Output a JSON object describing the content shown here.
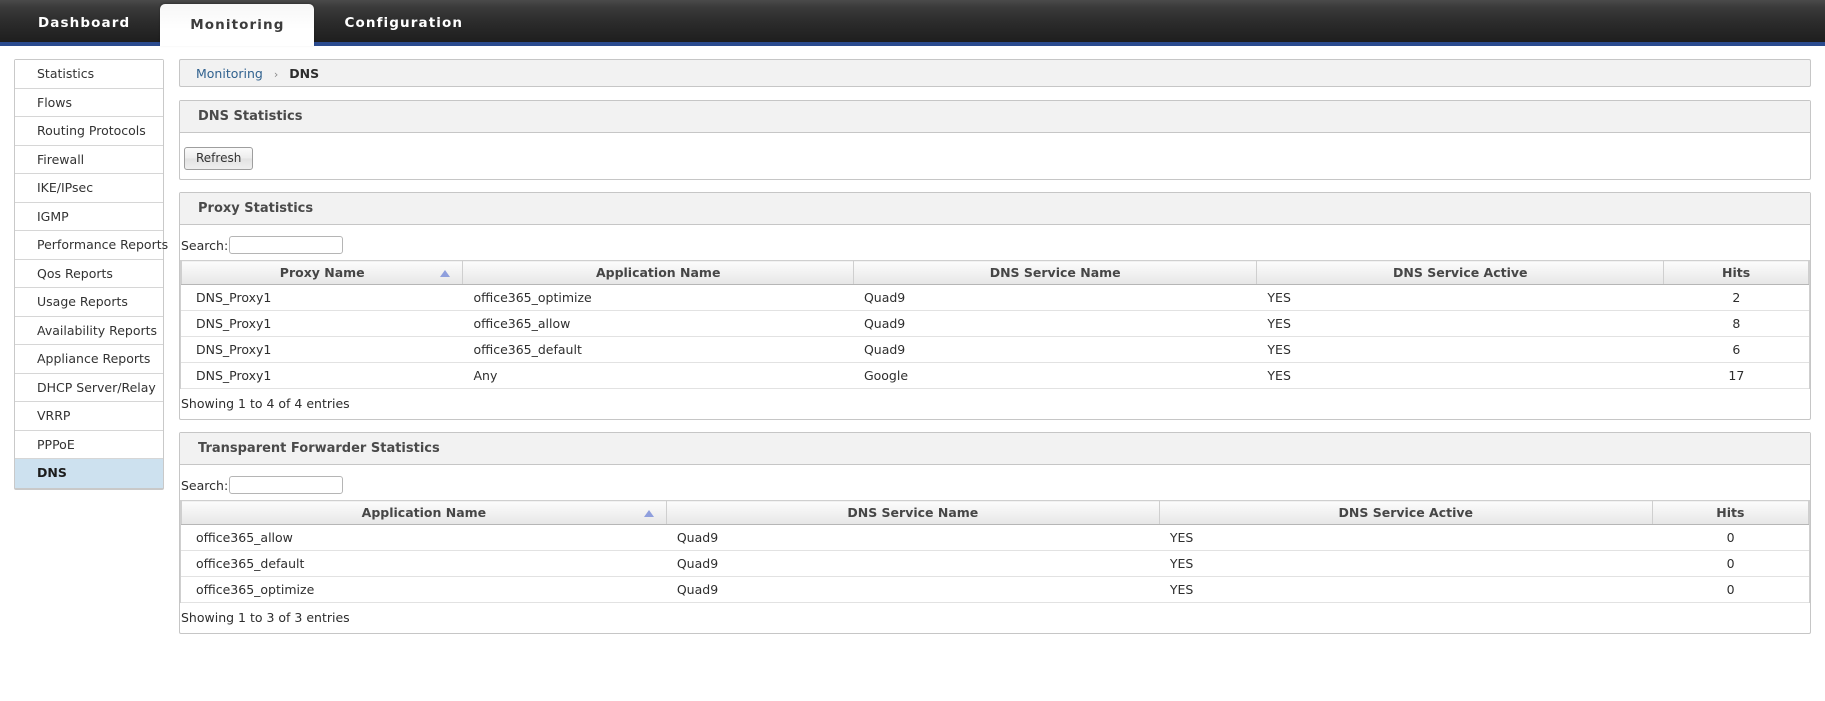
{
  "topnav": {
    "tabs": [
      {
        "label": "Dashboard",
        "active": false
      },
      {
        "label": "Monitoring",
        "active": true
      },
      {
        "label": "Configuration",
        "active": false
      }
    ],
    "accent_color": "#2b4b8f"
  },
  "sidebar": {
    "items": [
      {
        "label": "Statistics"
      },
      {
        "label": "Flows"
      },
      {
        "label": "Routing Protocols"
      },
      {
        "label": "Firewall"
      },
      {
        "label": "IKE/IPsec"
      },
      {
        "label": "IGMP"
      },
      {
        "label": "Performance Reports"
      },
      {
        "label": "Qos Reports"
      },
      {
        "label": "Usage Reports"
      },
      {
        "label": "Availability Reports"
      },
      {
        "label": "Appliance Reports"
      },
      {
        "label": "DHCP Server/Relay"
      },
      {
        "label": "VRRP"
      },
      {
        "label": "PPPoE"
      },
      {
        "label": "DNS"
      }
    ],
    "selected_index": 14,
    "selected_color": "#cde1ef"
  },
  "breadcrumb": {
    "root": "Monitoring",
    "separator": "›",
    "current": "DNS"
  },
  "dns_statistics": {
    "title": "DNS Statistics",
    "refresh_label": "Refresh"
  },
  "proxy_statistics": {
    "title": "Proxy Statistics",
    "search_label": "Search:",
    "search_value": "",
    "search_placeholder": "",
    "columns": [
      {
        "label": "Proxy Name",
        "sorted": "asc"
      },
      {
        "label": "Application Name",
        "sorted": ""
      },
      {
        "label": "DNS Service Name",
        "sorted": ""
      },
      {
        "label": "DNS Service Active",
        "sorted": ""
      },
      {
        "label": "Hits",
        "sorted": ""
      }
    ],
    "rows": [
      [
        "DNS_Proxy1",
        "office365_optimize",
        "Quad9",
        "YES",
        "2"
      ],
      [
        "DNS_Proxy1",
        "office365_allow",
        "Quad9",
        "YES",
        "8"
      ],
      [
        "DNS_Proxy1",
        "office365_default",
        "Quad9",
        "YES",
        "6"
      ],
      [
        "DNS_Proxy1",
        "Any",
        "Google",
        "YES",
        "17"
      ]
    ],
    "footer_info": "Showing 1 to 4 of 4 entries"
  },
  "transparent_forwarder_statistics": {
    "title": "Transparent Forwarder Statistics",
    "search_label": "Search:",
    "search_value": "",
    "search_placeholder": "",
    "columns": [
      {
        "label": "Application Name",
        "sorted": "asc"
      },
      {
        "label": "DNS Service Name",
        "sorted": ""
      },
      {
        "label": "DNS Service Active",
        "sorted": ""
      },
      {
        "label": "Hits",
        "sorted": ""
      }
    ],
    "rows": [
      [
        "office365_allow",
        "Quad9",
        "YES",
        "0"
      ],
      [
        "office365_default",
        "Quad9",
        "YES",
        "0"
      ],
      [
        "office365_optimize",
        "Quad9",
        "YES",
        "0"
      ]
    ],
    "footer_info": "Showing 1 to 3 of 3 entries"
  }
}
